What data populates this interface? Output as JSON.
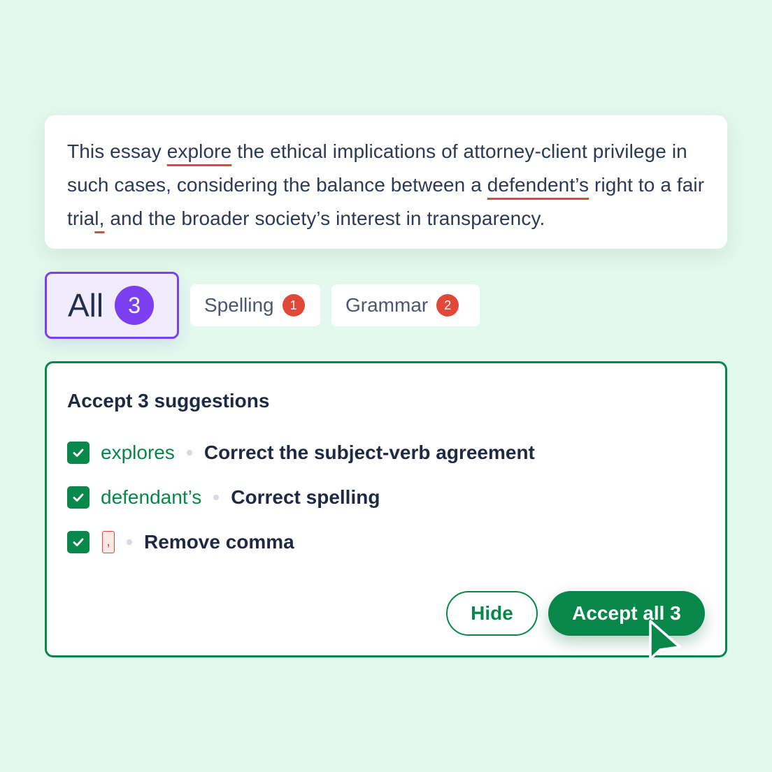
{
  "essay": {
    "segments": [
      {
        "text": "This essay ",
        "error": false
      },
      {
        "text": "explore",
        "error": true
      },
      {
        "text": " the ethical implications of attorney-client privilege in such cases, considering the balance between a ",
        "error": false
      },
      {
        "text": "defendent’s",
        "error": true
      },
      {
        "text": " right to a fair tria",
        "error": false
      },
      {
        "text": "l,",
        "error": true
      },
      {
        "text": " and the broader society’s interest in transparency.",
        "error": false
      }
    ]
  },
  "tabs": {
    "all": {
      "label": "All",
      "count": "3"
    },
    "spelling": {
      "label": "Spelling",
      "count": "1"
    },
    "grammar": {
      "label": "Grammar",
      "count": "2"
    }
  },
  "panel": {
    "title": "Accept 3 suggestions",
    "suggestions": [
      {
        "replacement": "explores",
        "description": "Correct the subject-verb agreement",
        "checked": true
      },
      {
        "replacement": "defendant’s",
        "description": "Correct spelling",
        "checked": true
      },
      {
        "removed": ",",
        "description": "Remove comma",
        "checked": true
      }
    ],
    "hide_label": "Hide",
    "accept_label": "Accept all 3"
  },
  "colors": {
    "background": "#e3f8ee",
    "accent_purple": "#7b3ff0",
    "accent_green": "#07874a",
    "error_red": "#e0483a",
    "text_dark": "#1e2a44"
  },
  "icons": [
    "check-icon",
    "mouse-pointer-icon"
  ]
}
